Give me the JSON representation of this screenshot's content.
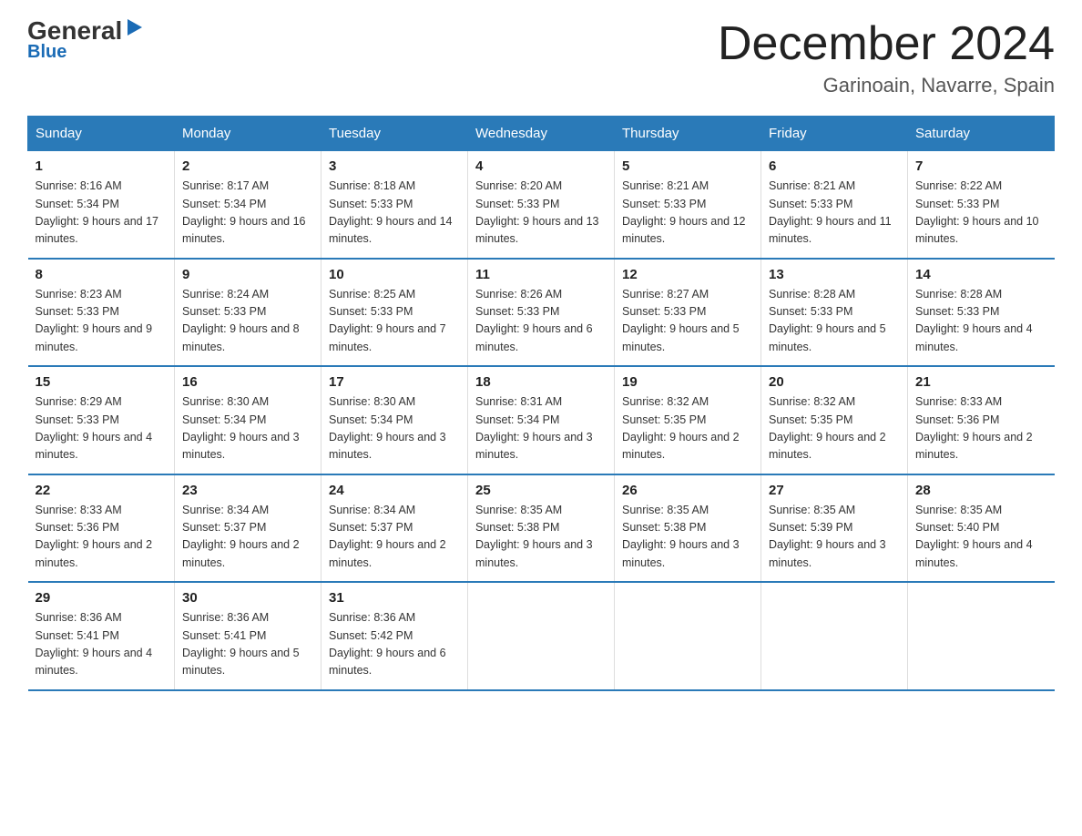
{
  "logo": {
    "general": "General",
    "blue": "Blue",
    "triangle": "▶"
  },
  "header": {
    "month_year": "December 2024",
    "location": "Garinoain, Navarre, Spain"
  },
  "weekdays": [
    "Sunday",
    "Monday",
    "Tuesday",
    "Wednesday",
    "Thursday",
    "Friday",
    "Saturday"
  ],
  "weeks": [
    [
      {
        "day": "1",
        "sunrise": "8:16 AM",
        "sunset": "5:34 PM",
        "daylight": "9 hours and 17 minutes."
      },
      {
        "day": "2",
        "sunrise": "8:17 AM",
        "sunset": "5:34 PM",
        "daylight": "9 hours and 16 minutes."
      },
      {
        "day": "3",
        "sunrise": "8:18 AM",
        "sunset": "5:33 PM",
        "daylight": "9 hours and 14 minutes."
      },
      {
        "day": "4",
        "sunrise": "8:20 AM",
        "sunset": "5:33 PM",
        "daylight": "9 hours and 13 minutes."
      },
      {
        "day": "5",
        "sunrise": "8:21 AM",
        "sunset": "5:33 PM",
        "daylight": "9 hours and 12 minutes."
      },
      {
        "day": "6",
        "sunrise": "8:21 AM",
        "sunset": "5:33 PM",
        "daylight": "9 hours and 11 minutes."
      },
      {
        "day": "7",
        "sunrise": "8:22 AM",
        "sunset": "5:33 PM",
        "daylight": "9 hours and 10 minutes."
      }
    ],
    [
      {
        "day": "8",
        "sunrise": "8:23 AM",
        "sunset": "5:33 PM",
        "daylight": "9 hours and 9 minutes."
      },
      {
        "day": "9",
        "sunrise": "8:24 AM",
        "sunset": "5:33 PM",
        "daylight": "9 hours and 8 minutes."
      },
      {
        "day": "10",
        "sunrise": "8:25 AM",
        "sunset": "5:33 PM",
        "daylight": "9 hours and 7 minutes."
      },
      {
        "day": "11",
        "sunrise": "8:26 AM",
        "sunset": "5:33 PM",
        "daylight": "9 hours and 6 minutes."
      },
      {
        "day": "12",
        "sunrise": "8:27 AM",
        "sunset": "5:33 PM",
        "daylight": "9 hours and 5 minutes."
      },
      {
        "day": "13",
        "sunrise": "8:28 AM",
        "sunset": "5:33 PM",
        "daylight": "9 hours and 5 minutes."
      },
      {
        "day": "14",
        "sunrise": "8:28 AM",
        "sunset": "5:33 PM",
        "daylight": "9 hours and 4 minutes."
      }
    ],
    [
      {
        "day": "15",
        "sunrise": "8:29 AM",
        "sunset": "5:33 PM",
        "daylight": "9 hours and 4 minutes."
      },
      {
        "day": "16",
        "sunrise": "8:30 AM",
        "sunset": "5:34 PM",
        "daylight": "9 hours and 3 minutes."
      },
      {
        "day": "17",
        "sunrise": "8:30 AM",
        "sunset": "5:34 PM",
        "daylight": "9 hours and 3 minutes."
      },
      {
        "day": "18",
        "sunrise": "8:31 AM",
        "sunset": "5:34 PM",
        "daylight": "9 hours and 3 minutes."
      },
      {
        "day": "19",
        "sunrise": "8:32 AM",
        "sunset": "5:35 PM",
        "daylight": "9 hours and 2 minutes."
      },
      {
        "day": "20",
        "sunrise": "8:32 AM",
        "sunset": "5:35 PM",
        "daylight": "9 hours and 2 minutes."
      },
      {
        "day": "21",
        "sunrise": "8:33 AM",
        "sunset": "5:36 PM",
        "daylight": "9 hours and 2 minutes."
      }
    ],
    [
      {
        "day": "22",
        "sunrise": "8:33 AM",
        "sunset": "5:36 PM",
        "daylight": "9 hours and 2 minutes."
      },
      {
        "day": "23",
        "sunrise": "8:34 AM",
        "sunset": "5:37 PM",
        "daylight": "9 hours and 2 minutes."
      },
      {
        "day": "24",
        "sunrise": "8:34 AM",
        "sunset": "5:37 PM",
        "daylight": "9 hours and 2 minutes."
      },
      {
        "day": "25",
        "sunrise": "8:35 AM",
        "sunset": "5:38 PM",
        "daylight": "9 hours and 3 minutes."
      },
      {
        "day": "26",
        "sunrise": "8:35 AM",
        "sunset": "5:38 PM",
        "daylight": "9 hours and 3 minutes."
      },
      {
        "day": "27",
        "sunrise": "8:35 AM",
        "sunset": "5:39 PM",
        "daylight": "9 hours and 3 minutes."
      },
      {
        "day": "28",
        "sunrise": "8:35 AM",
        "sunset": "5:40 PM",
        "daylight": "9 hours and 4 minutes."
      }
    ],
    [
      {
        "day": "29",
        "sunrise": "8:36 AM",
        "sunset": "5:41 PM",
        "daylight": "9 hours and 4 minutes."
      },
      {
        "day": "30",
        "sunrise": "8:36 AM",
        "sunset": "5:41 PM",
        "daylight": "9 hours and 5 minutes."
      },
      {
        "day": "31",
        "sunrise": "8:36 AM",
        "sunset": "5:42 PM",
        "daylight": "9 hours and 6 minutes."
      },
      null,
      null,
      null,
      null
    ]
  ],
  "labels": {
    "sunrise": "Sunrise:",
    "sunset": "Sunset:",
    "daylight": "Daylight:"
  }
}
